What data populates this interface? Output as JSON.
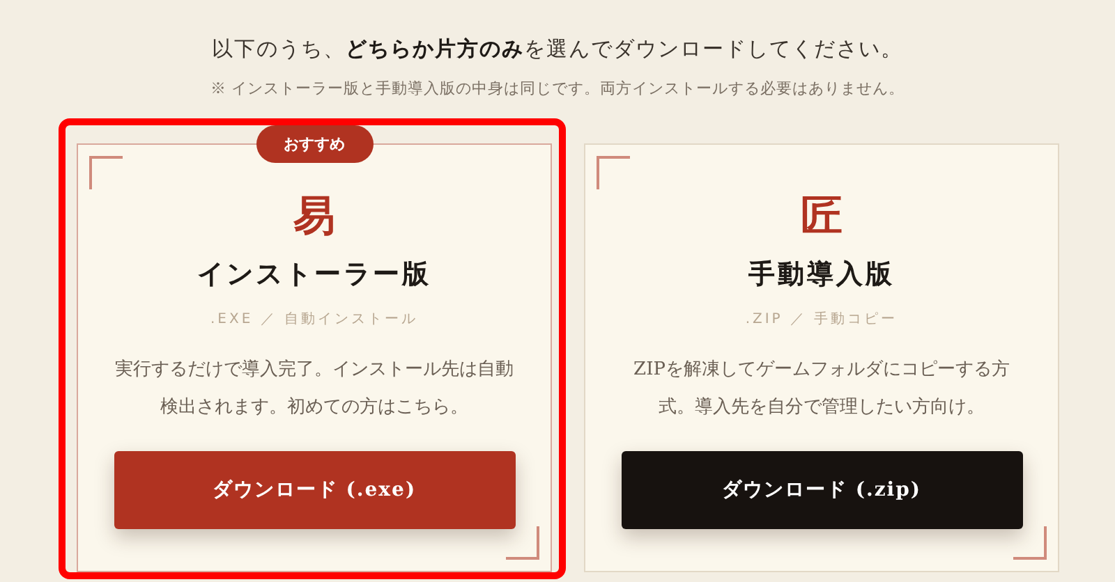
{
  "heading": "以下のうち、**どちらか片方のみ**を選んでダウンロードしてください。",
  "note": "※ インストーラー版と手動導入版の中身は同じです。両方インストールする必要はありません。",
  "options": [
    {
      "kind": "primary",
      "highlighted": true,
      "badge": "おすすめ",
      "glyph": "易",
      "title": "インストーラー版",
      "subtitle": ".EXE ／ 自動インストール",
      "description": "実行するだけで導入完了。インストール先は自動検出されます。初めての方はこちら。",
      "button": "ダウンロード (.exe)"
    },
    {
      "kind": "secondary",
      "highlighted": false,
      "glyph": "匠",
      "title": "手動導入版",
      "subtitle": ".ZIP ／ 手動コピー",
      "description": "ZIPを解凍してゲームフォルダにコピーする方式。導入先を自分で管理したい方向け。",
      "button": "ダウンロード (.zip)"
    }
  ]
}
